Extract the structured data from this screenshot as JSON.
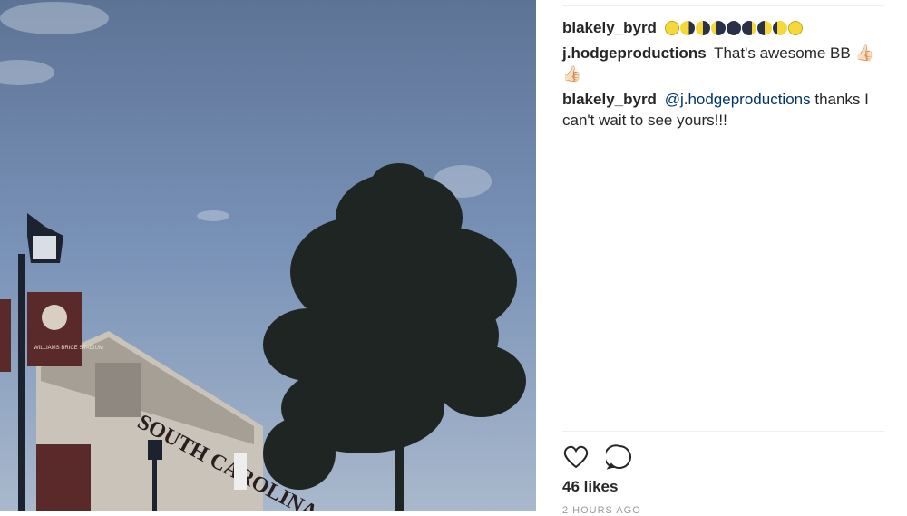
{
  "photo": {
    "alt_icon": "photo-post",
    "banner_text": "WILLIAMS BRICE STADIUM",
    "sign_text": "SOUTH CAROLINA"
  },
  "comments": [
    {
      "user": "blakely_byrd",
      "text": "",
      "emoji": [
        "🌕",
        "🌖",
        "🌗",
        "🌘",
        "🌑",
        "🌒",
        "🌓",
        "🌔",
        "🌕"
      ]
    },
    {
      "user": "j.hodgeproductions",
      "text": "That's awesome BB 👍🏻 👍🏻"
    },
    {
      "user": "blakely_byrd",
      "mention": "@j.hodgeproductions",
      "text": "thanks I can't wait to see yours!!!"
    }
  ],
  "actions": {
    "like_icon": "heart-icon",
    "comment_icon": "comment-icon"
  },
  "likes": "46 likes",
  "timestamp": "2 HOURS AGO",
  "colors": {
    "mention": "#003569",
    "text": "#262626",
    "divider": "#efefef"
  }
}
